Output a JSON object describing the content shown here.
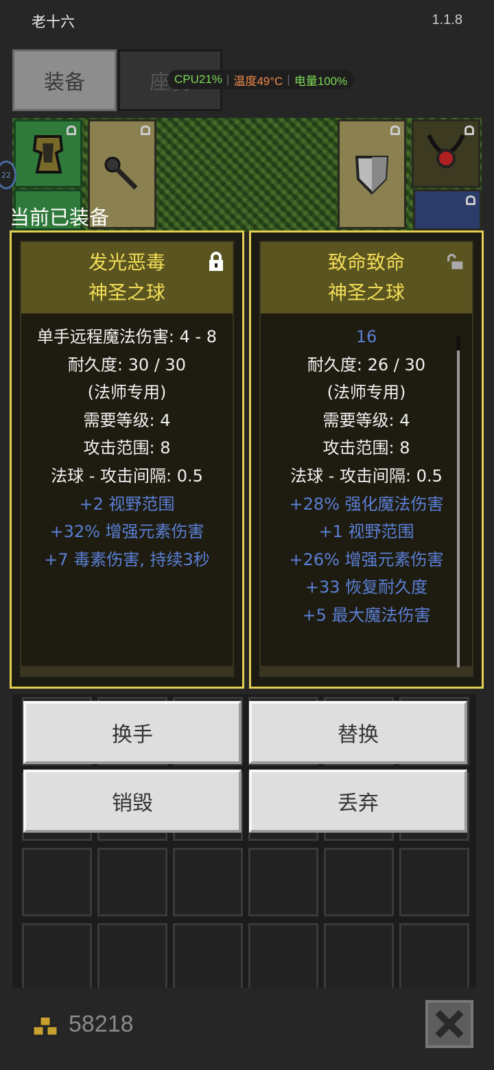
{
  "status_bar": {
    "title": "老十六",
    "version": "1.1.8"
  },
  "tabs": [
    {
      "label": "装备"
    },
    {
      "label": "座骑"
    }
  ],
  "perf_overlay": {
    "cpu": "CPU21%",
    "temp": "温度49°C",
    "battery": "电量100%"
  },
  "equipped_label": "当前已装备",
  "items": [
    {
      "name_line1": "发光恶毒",
      "name_line2": "神圣之球",
      "lock_state": "locked",
      "stats": [
        {
          "text": "单手远程魔法伤害: 4 - 8",
          "kind": "base"
        },
        {
          "text": "耐久度: 30 / 30",
          "kind": "base"
        },
        {
          "text": "(法师专用)",
          "kind": "base"
        },
        {
          "text": "需要等级: 4",
          "kind": "base"
        },
        {
          "text": "攻击范围: 8",
          "kind": "base"
        },
        {
          "text": "法球 - 攻击间隔: 0.5",
          "kind": "base"
        },
        {
          "text": "+2 视野范围",
          "kind": "bonus"
        },
        {
          "text": "+32% 增强元素伤害",
          "kind": "bonus"
        },
        {
          "text": "+7 毒素伤害, 持续3秒",
          "kind": "bonus"
        }
      ]
    },
    {
      "name_line1": "致命致命",
      "name_line2": "神圣之球",
      "lock_state": "unlocked",
      "stats": [
        {
          "text": "16",
          "kind": "bonus"
        },
        {
          "text": "耐久度: 26 / 30",
          "kind": "base"
        },
        {
          "text": "(法师专用)",
          "kind": "base"
        },
        {
          "text": "需要等级: 4",
          "kind": "base"
        },
        {
          "text": "攻击范围: 8",
          "kind": "base"
        },
        {
          "text": "法球 - 攻击间隔: 0.5",
          "kind": "base"
        },
        {
          "text": "+28% 强化魔法伤害",
          "kind": "bonus"
        },
        {
          "text": "+1 视野范围",
          "kind": "bonus"
        },
        {
          "text": "+26% 增强元素伤害",
          "kind": "bonus"
        },
        {
          "text": "+33 恢复耐久度",
          "kind": "bonus"
        },
        {
          "text": "+5 最大魔法伤害",
          "kind": "bonus"
        }
      ]
    }
  ],
  "actions": {
    "swap_hand": "换手",
    "replace": "替换",
    "destroy": "销毁",
    "discard": "丢弃"
  },
  "gold": "58218",
  "colors": {
    "accent_gold": "#e3cf52",
    "bonus_blue": "#5b7fd6"
  }
}
